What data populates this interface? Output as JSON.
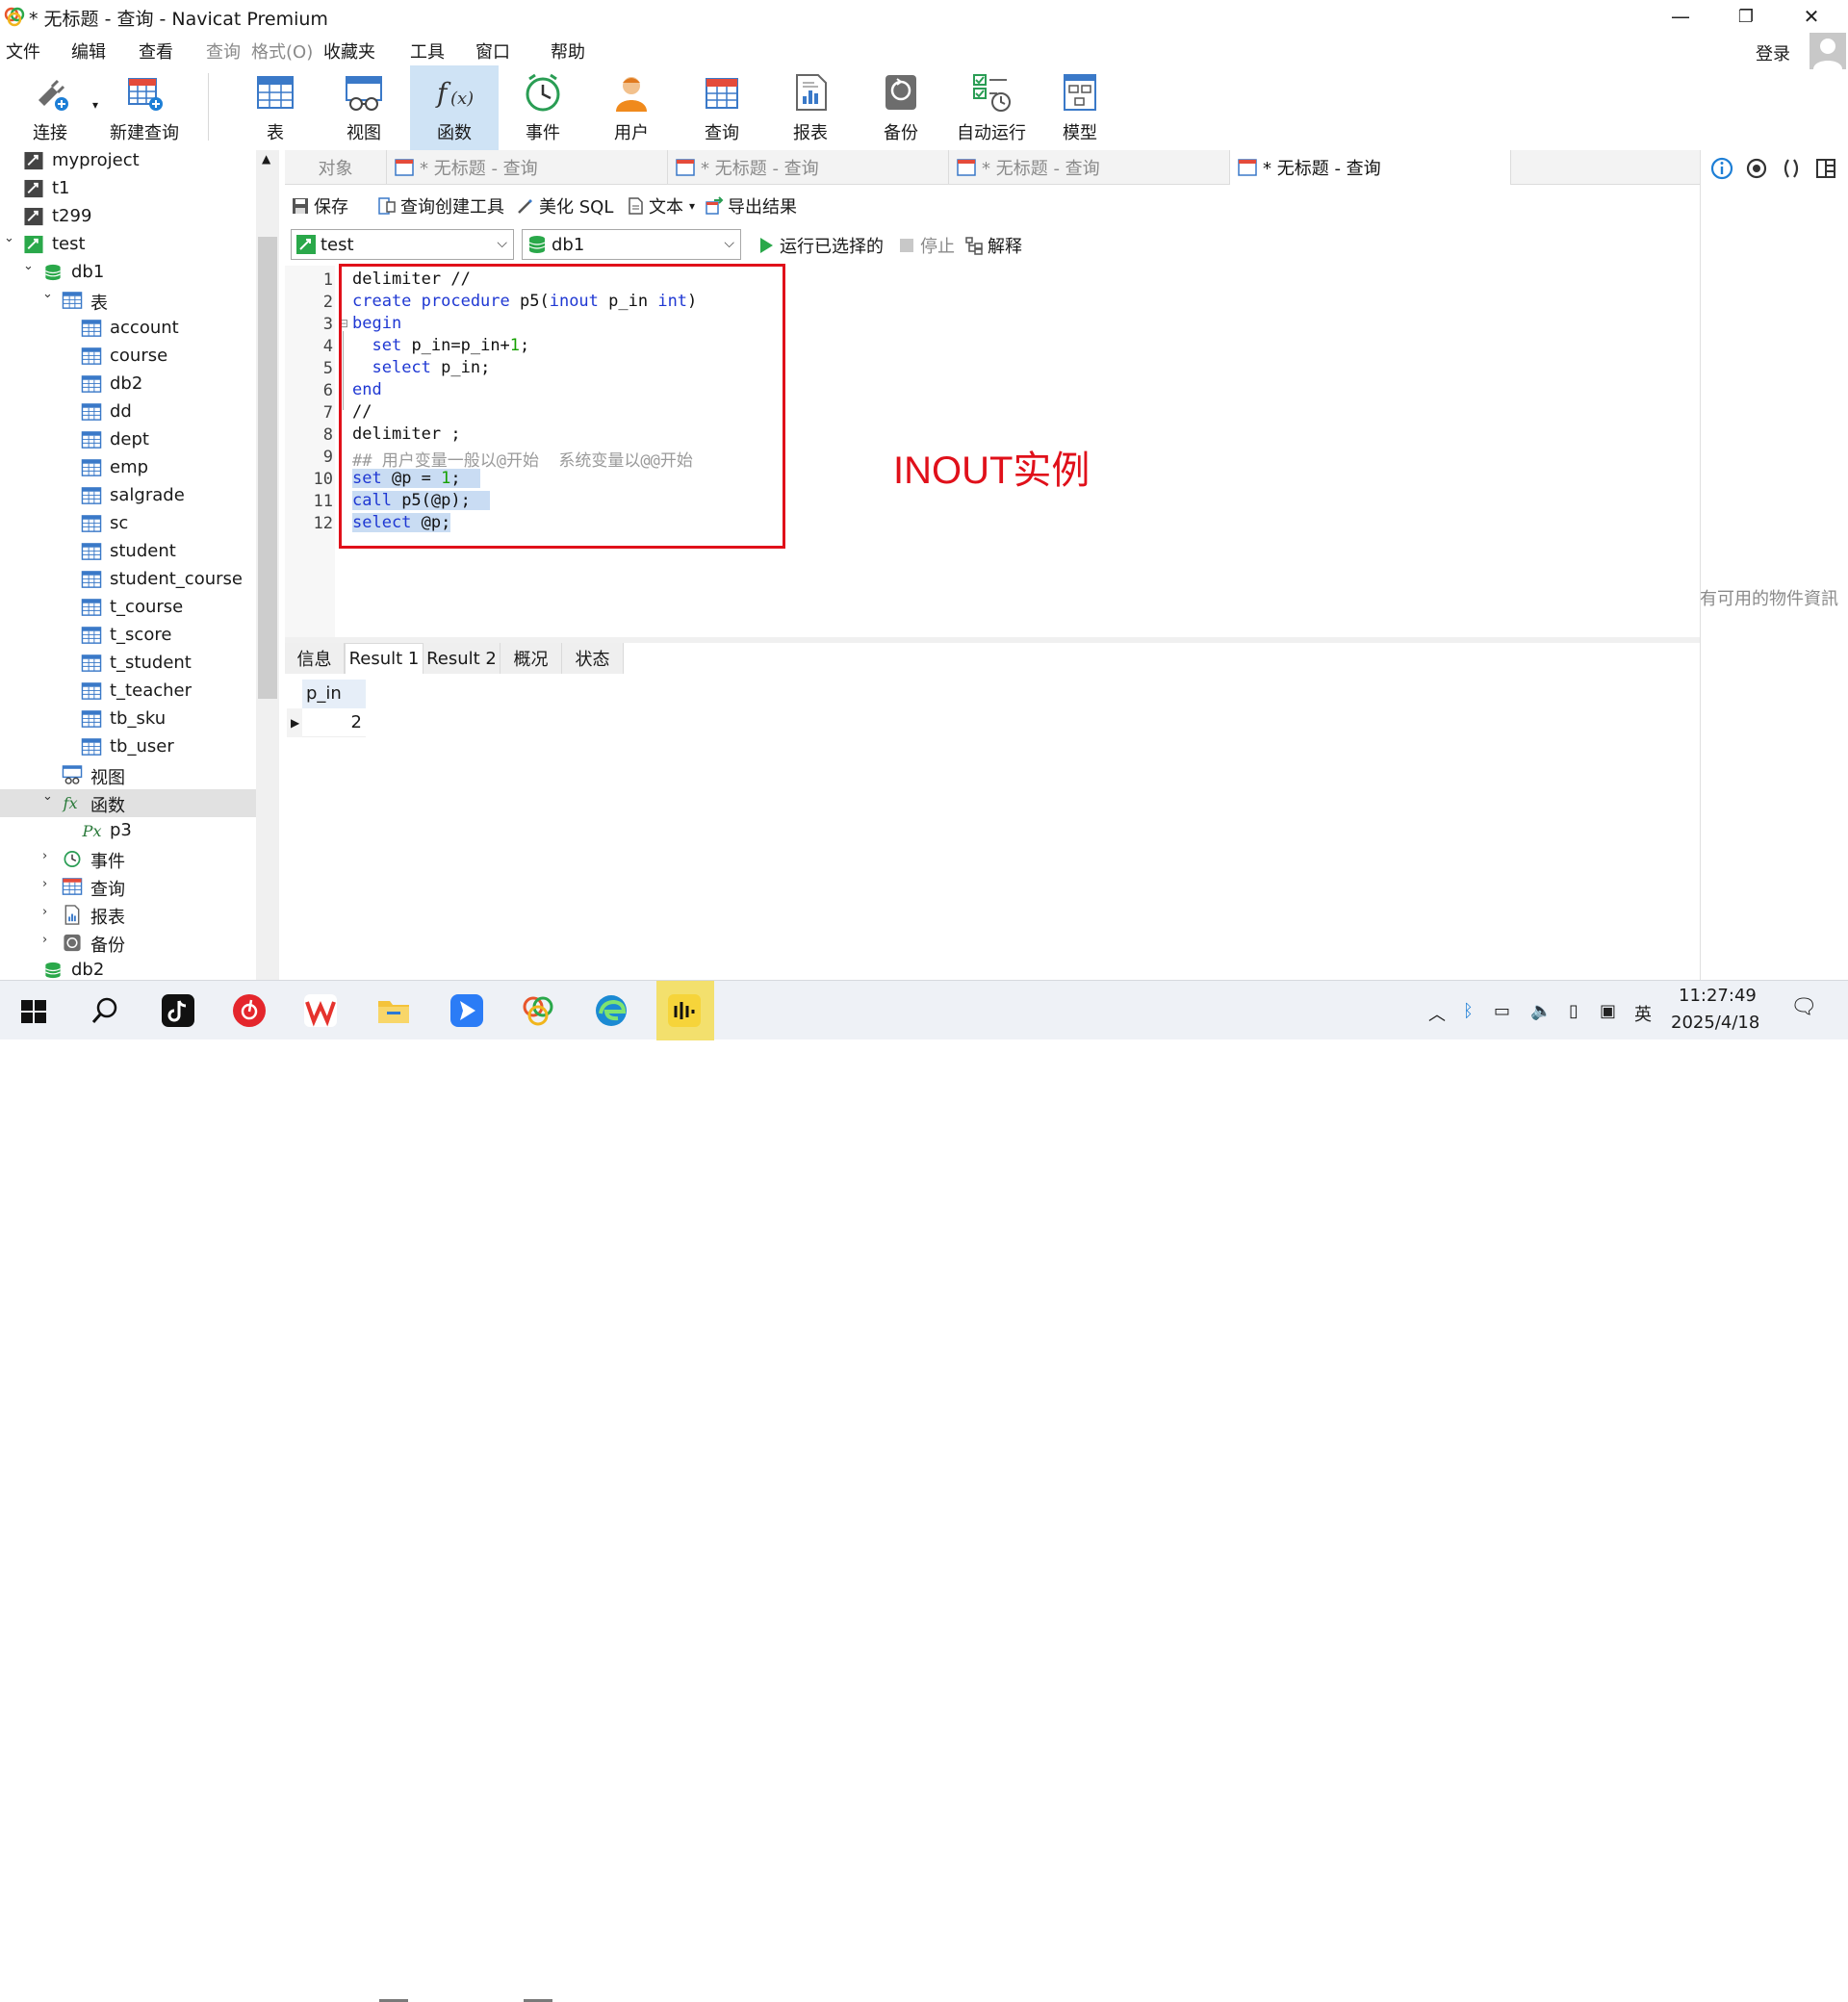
{
  "window": {
    "title": "* 无标题 - 查询 - Navicat Premium",
    "minimize": "—",
    "restore": "❐",
    "close": "✕"
  },
  "menu": [
    "文件",
    "编辑",
    "查看",
    "查询",
    "格式(O)",
    "收藏夹",
    "工具",
    "窗口",
    "帮助"
  ],
  "menu_disabled": [
    3,
    4
  ],
  "login": "登录",
  "toolbar": [
    "连接",
    "新建查询",
    "表",
    "视图",
    "函数",
    "事件",
    "用户",
    "查询",
    "报表",
    "备份",
    "自动运行",
    "模型"
  ],
  "toolbar_active": "函数",
  "sidebar": {
    "items": [
      {
        "label": "myproject",
        "level": 0,
        "icon": "connection-icon",
        "arrow": ""
      },
      {
        "label": "t1",
        "level": 0,
        "icon": "connection-icon",
        "arrow": ""
      },
      {
        "label": "t299",
        "level": 0,
        "icon": "connection-icon",
        "arrow": ""
      },
      {
        "label": "test",
        "level": 0,
        "icon": "connection-open-icon",
        "arrow": "down"
      },
      {
        "label": "db1",
        "level": 1,
        "icon": "database-icon",
        "arrow": "down"
      },
      {
        "label": "表",
        "level": 2,
        "icon": "table-icon",
        "arrow": "down"
      },
      {
        "label": "account",
        "level": 3,
        "icon": "table-icon",
        "arrow": ""
      },
      {
        "label": "course",
        "level": 3,
        "icon": "table-icon",
        "arrow": ""
      },
      {
        "label": "db2",
        "level": 3,
        "icon": "table-icon",
        "arrow": ""
      },
      {
        "label": "dd",
        "level": 3,
        "icon": "table-icon",
        "arrow": ""
      },
      {
        "label": "dept",
        "level": 3,
        "icon": "table-icon",
        "arrow": ""
      },
      {
        "label": "emp",
        "level": 3,
        "icon": "table-icon",
        "arrow": ""
      },
      {
        "label": "salgrade",
        "level": 3,
        "icon": "table-icon",
        "arrow": ""
      },
      {
        "label": "sc",
        "level": 3,
        "icon": "table-icon",
        "arrow": ""
      },
      {
        "label": "student",
        "level": 3,
        "icon": "table-icon",
        "arrow": ""
      },
      {
        "label": "student_course",
        "level": 3,
        "icon": "table-icon",
        "arrow": ""
      },
      {
        "label": "t_course",
        "level": 3,
        "icon": "table-icon",
        "arrow": ""
      },
      {
        "label": "t_score",
        "level": 3,
        "icon": "table-icon",
        "arrow": ""
      },
      {
        "label": "t_student",
        "level": 3,
        "icon": "table-icon",
        "arrow": ""
      },
      {
        "label": "t_teacher",
        "level": 3,
        "icon": "table-icon",
        "arrow": ""
      },
      {
        "label": "tb_sku",
        "level": 3,
        "icon": "table-icon",
        "arrow": ""
      },
      {
        "label": "tb_user",
        "level": 3,
        "icon": "table-icon",
        "arrow": ""
      },
      {
        "label": "视图",
        "level": 2,
        "icon": "view-icon",
        "arrow": ""
      },
      {
        "label": "函数",
        "level": 2,
        "icon": "function-icon",
        "arrow": "down",
        "selected": true
      },
      {
        "label": "p3",
        "level": 3,
        "icon": "procedure-icon",
        "arrow": ""
      },
      {
        "label": "事件",
        "level": 2,
        "icon": "event-icon",
        "arrow": "right"
      },
      {
        "label": "查询",
        "level": 2,
        "icon": "query-icon",
        "arrow": "right"
      },
      {
        "label": "报表",
        "level": 2,
        "icon": "report-icon",
        "arrow": "right"
      },
      {
        "label": "备份",
        "level": 2,
        "icon": "backup-icon",
        "arrow": "right"
      },
      {
        "label": "db2",
        "level": 1,
        "icon": "database-icon",
        "arrow": ""
      }
    ]
  },
  "tabs": {
    "object_label": "对象",
    "query_tabs": [
      "* 无标题 - 查询",
      "* 无标题 - 查询",
      "* 无标题 - 查询",
      "* 无标题 - 查询"
    ],
    "active_index": 3
  },
  "query_toolbar": {
    "save": "保存",
    "builder": "查询创建工具",
    "beautify": "美化 SQL",
    "text": "文本",
    "export": "导出结果"
  },
  "selectors": {
    "connection": "test",
    "database": "db1",
    "run_selected": "运行已选择的",
    "stop": "停止",
    "explain": "解释"
  },
  "editor": {
    "line_numbers": [
      "1",
      "2",
      "3",
      "4",
      "5",
      "6",
      "7",
      "8",
      "9",
      "10",
      "11",
      "12"
    ],
    "annotation": "INOUT实例"
  },
  "results": {
    "tabs": [
      "信息",
      "Result 1",
      "Result 2",
      "概况",
      "状态"
    ],
    "active_tab": "Result 1",
    "column": "p_in",
    "value": "2"
  },
  "right_panel": {
    "message": "有可用的物件資訊"
  },
  "taskbar": {
    "time": "11:27:49",
    "date": "2025/4/18",
    "ime": "英"
  },
  "colors": {
    "accent": "#1f38d3",
    "number": "#15a000",
    "highlight": "#c9dcf3",
    "annotation": "#e0101a",
    "active_toolbar": "#cfe3f5"
  }
}
